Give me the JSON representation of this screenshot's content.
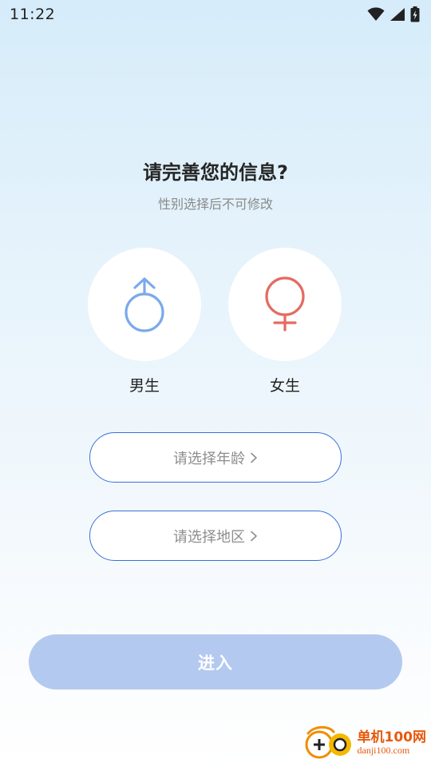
{
  "status_bar": {
    "time": "11:22"
  },
  "header": {
    "title": "请完善您的信息?",
    "subtitle": "性别选择后不可修改"
  },
  "gender": {
    "male_label": "男生",
    "female_label": "女生",
    "male_color": "#7aa9ec",
    "female_color": "#e56a60"
  },
  "form": {
    "age_placeholder": "请选择年龄",
    "region_placeholder": "请选择地区"
  },
  "enter_button": {
    "label": "进入",
    "color": "#b4c9f0"
  },
  "watermark": {
    "title": "单机100网",
    "url": "danji100.com"
  }
}
